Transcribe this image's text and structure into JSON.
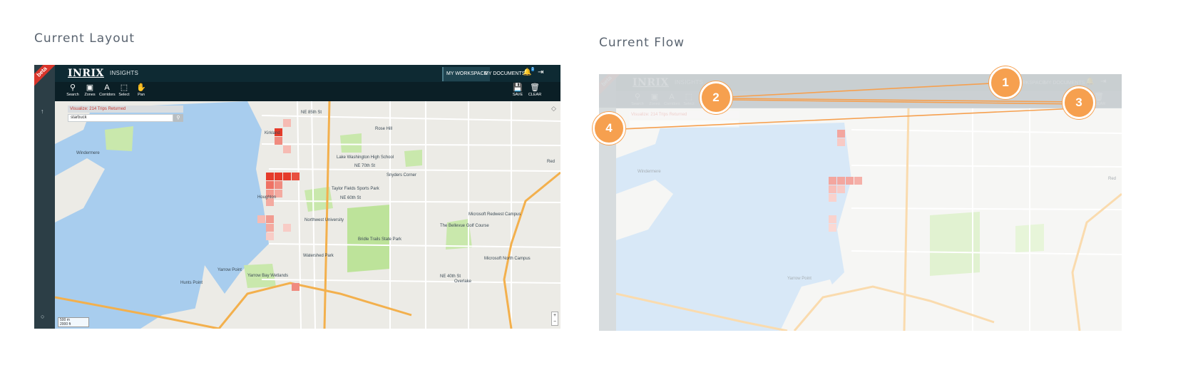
{
  "sections": {
    "layout_title": "Current Layout",
    "flow_title": "Current Flow"
  },
  "app": {
    "beta": "beta",
    "logo": "INRIX",
    "product": "INSIGHTS",
    "tabs": [
      {
        "label": "MY WORKSPACE",
        "active": true
      },
      {
        "label": "MY DOCUMENTS",
        "active": false
      }
    ],
    "notification_count": "1",
    "tools": [
      {
        "label": "Search",
        "icon": "search-icon"
      },
      {
        "label": "Zones",
        "icon": "zones-icon"
      },
      {
        "label": "Corridors",
        "icon": "corridors-icon"
      },
      {
        "label": "Select",
        "icon": "select-icon"
      },
      {
        "label": "Pan",
        "icon": "pan-icon"
      }
    ],
    "save_label": "SAVE",
    "clear_label": "CLEAR",
    "visualize_text": "Visualize: 214 Trips Returned",
    "search_value": "starbuck",
    "scale_m": "500 m",
    "scale_ft": "2000 ft"
  },
  "map_labels": {
    "kirkland": "Kirkland",
    "houghton": "Houghton",
    "yarrow_point": "Yarrow Point",
    "hunts_point": "Hunts Point",
    "bridle_trails": "Bridle Trails State Park",
    "snyders_corner": "Snyders Corner",
    "overlake": "Overlake",
    "redmond": "Red",
    "northwest_university": "Northwest University",
    "lake_washington_hs": "Lake Washington High School",
    "watershed_park": "Watershed Park",
    "yarrow_bay_wetlands": "Yarrow Bay Wetlands",
    "windermere": "Windermere",
    "taylor_fields": "Taylor Fields Sports Park",
    "microsoft_redwest": "Microsoft Redwest Campus",
    "microsoft_north": "Microsoft North Campus",
    "bellevue_golf": "The Bellevue Golf Course",
    "rose_hill": "Rose Hill",
    "ne_85th": "NE 85th St",
    "ne_70th": "NE 70th St",
    "ne_60th": "NE 60th St",
    "ne_40th": "NE 40th St"
  },
  "flow_steps": [
    "1",
    "2",
    "3",
    "4"
  ],
  "colors": {
    "accent": "#f6a04f",
    "topbar": "#0e2a33",
    "water": "#a8cdee",
    "park": "#bde39a",
    "heat": "#e53b2a"
  }
}
